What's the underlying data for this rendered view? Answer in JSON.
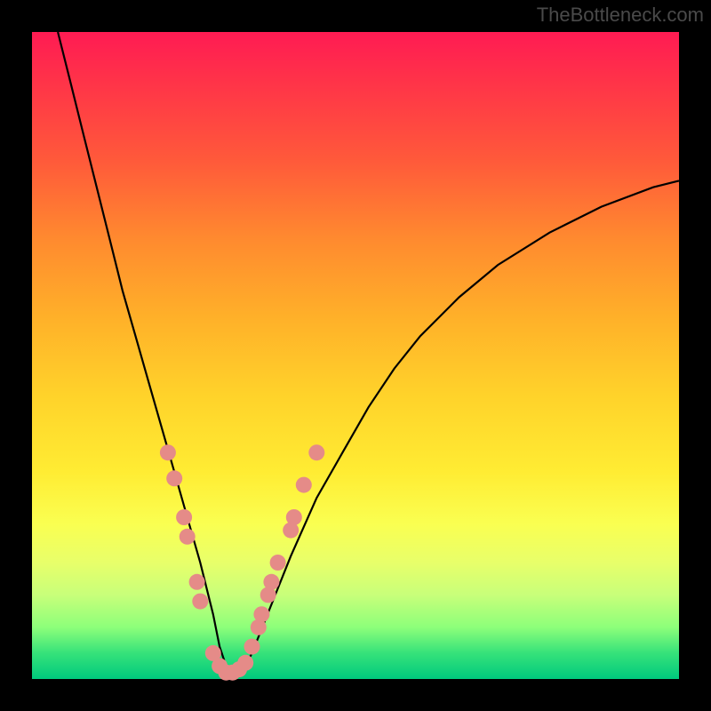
{
  "watermark": "TheBottleneck.com",
  "chart_data": {
    "type": "line",
    "title": "",
    "xlabel": "",
    "ylabel": "",
    "xlim": [
      0,
      100
    ],
    "ylim": [
      0,
      100
    ],
    "note": "Background gradient encodes score: red (high/bad) at top to green (low/good) at bottom. V-shaped curve shows bottleneck % vs component balance; minimum ≈0 near x≈30. Pink markers highlight near-optimal region on both branches.",
    "series": [
      {
        "name": "bottleneck-curve",
        "x": [
          4,
          6,
          8,
          10,
          12,
          14,
          16,
          18,
          20,
          22,
          24,
          26,
          28,
          29,
          30,
          31,
          32,
          33,
          34,
          36,
          38,
          40,
          44,
          48,
          52,
          56,
          60,
          66,
          72,
          80,
          88,
          96,
          100
        ],
        "y": [
          100,
          92,
          84,
          76,
          68,
          60,
          53,
          46,
          39,
          32,
          25,
          18,
          10,
          5,
          2,
          1,
          1,
          2,
          4,
          9,
          14,
          19,
          28,
          35,
          42,
          48,
          53,
          59,
          64,
          69,
          73,
          76,
          77
        ]
      }
    ],
    "markers": {
      "name": "near-optimal-points",
      "color": "#e58b88",
      "points": [
        {
          "x": 21,
          "y": 35
        },
        {
          "x": 22,
          "y": 31
        },
        {
          "x": 23.5,
          "y": 25
        },
        {
          "x": 24,
          "y": 22
        },
        {
          "x": 25.5,
          "y": 15
        },
        {
          "x": 26,
          "y": 12
        },
        {
          "x": 28,
          "y": 4
        },
        {
          "x": 29,
          "y": 2
        },
        {
          "x": 30,
          "y": 1
        },
        {
          "x": 31,
          "y": 1
        },
        {
          "x": 32,
          "y": 1.5
        },
        {
          "x": 33,
          "y": 2.5
        },
        {
          "x": 34,
          "y": 5
        },
        {
          "x": 35,
          "y": 8
        },
        {
          "x": 35.5,
          "y": 10
        },
        {
          "x": 36.5,
          "y": 13
        },
        {
          "x": 37,
          "y": 15
        },
        {
          "x": 38,
          "y": 18
        },
        {
          "x": 40,
          "y": 23
        },
        {
          "x": 40.5,
          "y": 25
        },
        {
          "x": 42,
          "y": 30
        },
        {
          "x": 44,
          "y": 35
        }
      ]
    }
  }
}
